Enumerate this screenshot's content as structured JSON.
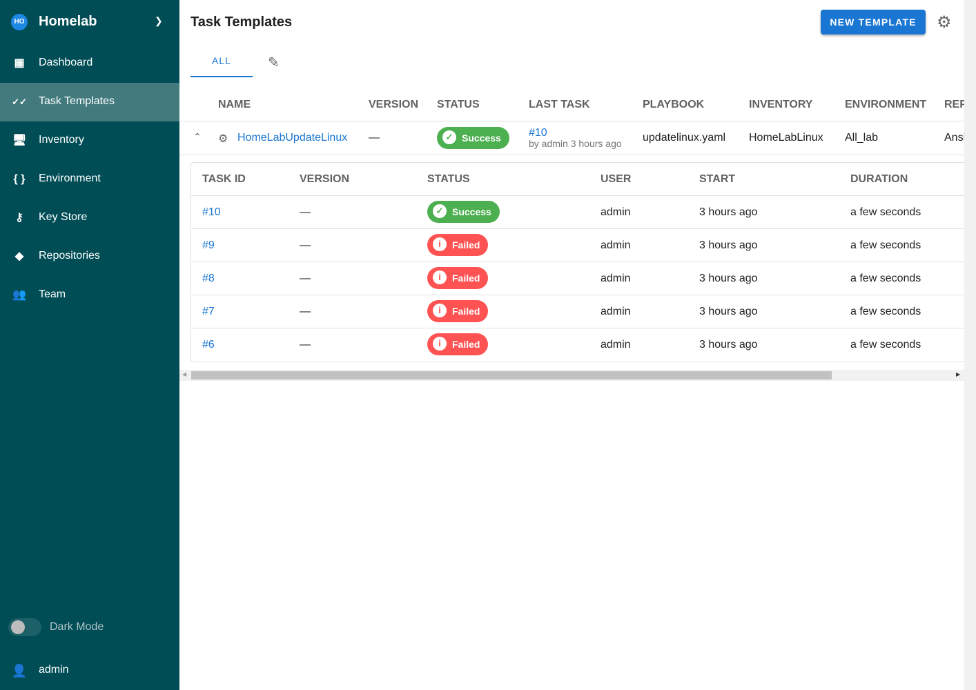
{
  "sidebar": {
    "project_initials": "HO",
    "project_name": "Homelab",
    "items": [
      {
        "label": "Dashboard",
        "icon": "dashboard-icon"
      },
      {
        "label": "Task Templates",
        "icon": "double-check-icon",
        "active": true
      },
      {
        "label": "Inventory",
        "icon": "monitor-icon"
      },
      {
        "label": "Environment",
        "icon": "braces-icon"
      },
      {
        "label": "Key Store",
        "icon": "key-icon"
      },
      {
        "label": "Repositories",
        "icon": "git-icon"
      },
      {
        "label": "Team",
        "icon": "team-icon"
      }
    ],
    "dark_mode_label": "Dark Mode",
    "dark_mode": false,
    "user": "admin"
  },
  "header": {
    "title": "Task Templates",
    "new_button": "NEW TEMPLATE",
    "tab_all": "ALL"
  },
  "table": {
    "columns": [
      "NAME",
      "VERSION",
      "STATUS",
      "LAST TASK",
      "PLAYBOOK",
      "INVENTORY",
      "ENVIRONMENT",
      "REP"
    ],
    "row": {
      "name": "HomeLabUpdateLinux",
      "version": "—",
      "status": "Success",
      "last_task_id": "#10",
      "last_task_meta": "by admin 3 hours ago",
      "playbook": "updatelinux.yaml",
      "inventory": "HomeLabLinux",
      "environment": "All_lab",
      "repository": "Ansi"
    }
  },
  "tasks": {
    "columns": [
      "TASK ID",
      "VERSION",
      "STATUS",
      "USER",
      "START",
      "DURATION"
    ],
    "rows": [
      {
        "id": "#10",
        "version": "—",
        "status": "Success",
        "user": "admin",
        "start": "3 hours ago",
        "duration": "a few seconds"
      },
      {
        "id": "#9",
        "version": "—",
        "status": "Failed",
        "user": "admin",
        "start": "3 hours ago",
        "duration": "a few seconds"
      },
      {
        "id": "#8",
        "version": "—",
        "status": "Failed",
        "user": "admin",
        "start": "3 hours ago",
        "duration": "a few seconds"
      },
      {
        "id": "#7",
        "version": "—",
        "status": "Failed",
        "user": "admin",
        "start": "3 hours ago",
        "duration": "a few seconds"
      },
      {
        "id": "#6",
        "version": "—",
        "status": "Failed",
        "user": "admin",
        "start": "3 hours ago",
        "duration": "a few seconds"
      }
    ]
  },
  "colors": {
    "sidebar": "#004d56",
    "accent": "#1976d2",
    "success": "#4caf50",
    "failed": "#ff5252"
  }
}
